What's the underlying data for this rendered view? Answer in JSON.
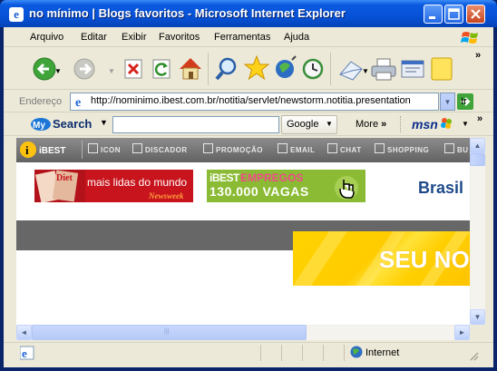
{
  "window": {
    "title": "no mínimo | Blogs favoritos - Microsoft Internet Explorer"
  },
  "menu": {
    "items": [
      "Arquivo",
      "Editar",
      "Exibir",
      "Favoritos",
      "Ferramentas",
      "Ajuda"
    ]
  },
  "toolbar": {
    "chevron": "»",
    "buttons": [
      "back-icon",
      "forward-icon",
      "stop-icon",
      "refresh-icon",
      "home-icon",
      "search-icon",
      "favorites-icon",
      "media-icon",
      "history-icon",
      "mail-icon",
      "print-icon",
      "edit-icon",
      "messenger-icon"
    ]
  },
  "address": {
    "label": "Endereço",
    "url": "http://nominimo.ibest.com.br/notitia/servlet/newstorm.notitia.presentation",
    "go_label": "Ir"
  },
  "searchbar": {
    "brand": "Search",
    "query": "",
    "google_label": "Google",
    "more_label": "More",
    "more_chevron": "»",
    "chevron": "»"
  },
  "page": {
    "ibest_logo": "iBEST",
    "ibest_tabs": [
      "ICON",
      "DISCADOR",
      "PROMOÇÃO",
      "EMAIL",
      "CHAT",
      "SHOPPING",
      "BU"
    ],
    "newsweek": {
      "mag_word": "Diet",
      "line1": "mais lidas do mundo",
      "line2": "Newsweek"
    },
    "empregos": {
      "brand": "iBEST",
      "word": "EMPREGOS",
      "vagas": "130.000 VAGAS"
    },
    "brasil": "Brasil",
    "yellow_ad": "SEU NO"
  },
  "statusbar": {
    "zone": "Internet"
  },
  "colors": {
    "titlebar": "#0752d7",
    "chrome": "#ece9d8",
    "ibest_bar": "#6e6e6e",
    "newsweek_red": "#c8141c",
    "empregos_green": "#8bbb34",
    "ad_yellow": "#ffcc00"
  }
}
